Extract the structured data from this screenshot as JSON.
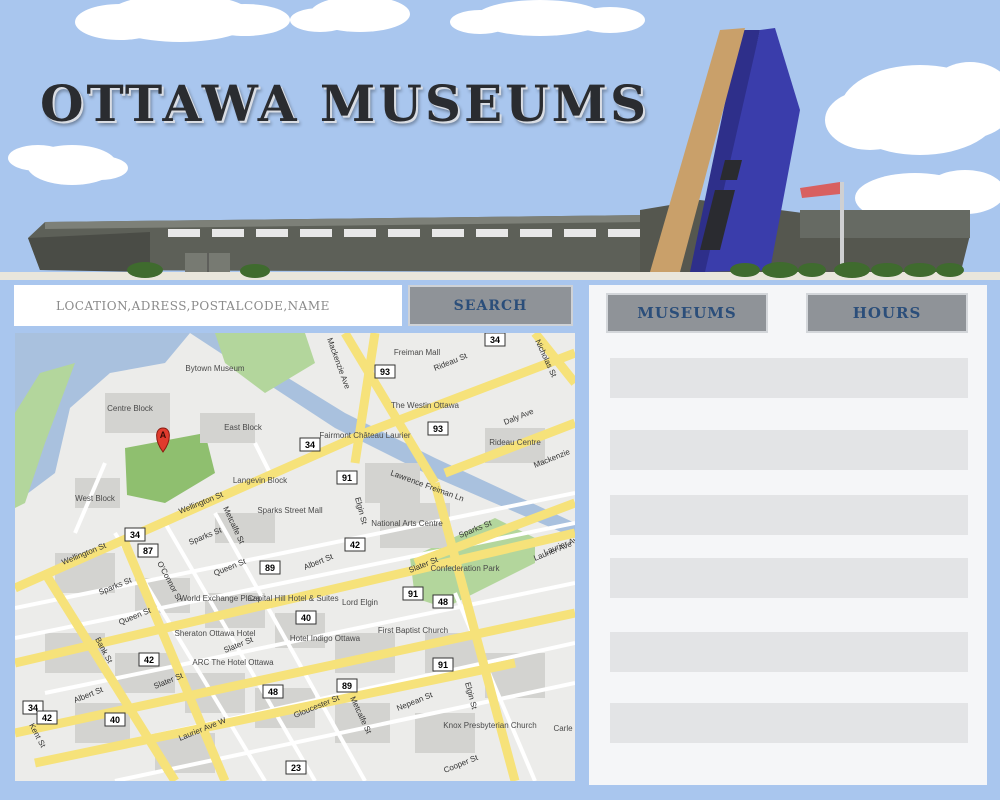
{
  "header": {
    "title": "OTTAWA MUSEUMS"
  },
  "search": {
    "placeholder": "LOCATION,ADRESS,POSTALCODE,NAME",
    "value": "",
    "button_label": "SEARCH"
  },
  "map": {
    "marker_label": "A",
    "road_labels": [
      "Wellington St",
      "Wellington St",
      "Sparks St",
      "Sparks St",
      "Sparks St",
      "Queen St",
      "Queen St",
      "Albert St",
      "Albert St",
      "Slater St",
      "Slater St",
      "Slater St",
      "Laurier Ave W",
      "Laurier Ave",
      "Mackenzie Ave",
      "Rideau St",
      "Nicholas St",
      "Daly Ave",
      "Elgin St",
      "Elgin St",
      "Metcalfe St",
      "Metcalfe St",
      "O'Connor St",
      "Bank St",
      "Kent St",
      "Gloucester St",
      "Nepean St",
      "Cooper St",
      "Lawrence Freiman Ln",
      "Mackenzie",
      "Laurier Ave"
    ],
    "place_labels": [
      "Freiman Mall",
      "Bytown Museum",
      "Centre Block",
      "East Block",
      "West Block",
      "Fairmont Château Laurier",
      "The Westin Ottawa",
      "Rideau Centre",
      "Langevin Block",
      "Sparks Street Mall",
      "National Arts Centre",
      "Confederation Park",
      "World Exchange Plaza",
      "Capital Hill Hotel & Suites",
      "Lord Elgin",
      "Sheraton Ottawa Hotel",
      "Hotel Indigo Ottawa",
      "First Baptist Church",
      "ARC The Hotel Ottawa",
      "Knox Presbyterian Church",
      "Carle"
    ],
    "route_shields": [
      "93",
      "34",
      "93",
      "34",
      "91",
      "42",
      "87",
      "34",
      "89",
      "91",
      "48",
      "40",
      "42",
      "91",
      "89",
      "48",
      "34",
      "40",
      "42",
      "23"
    ],
    "colors": {
      "land": "#ececea",
      "park": "#b3d69c",
      "water": "#a9c1de",
      "building": "#d3d3d0",
      "major_road": "#f6e27a",
      "minor_road": "#ffffff",
      "marker": "#e03b2d"
    }
  },
  "panel": {
    "museums_label": "MUSEUMS",
    "hours_label": "HOURS",
    "rows": [
      "",
      "",
      "",
      "",
      "",
      ""
    ]
  },
  "colors": {
    "sky": "#a9c6ee",
    "button_bg": "#8f9398",
    "button_text": "#2b4e7a",
    "panel_bg": "#f5f6f8",
    "row_bg": "#e3e4e6"
  }
}
